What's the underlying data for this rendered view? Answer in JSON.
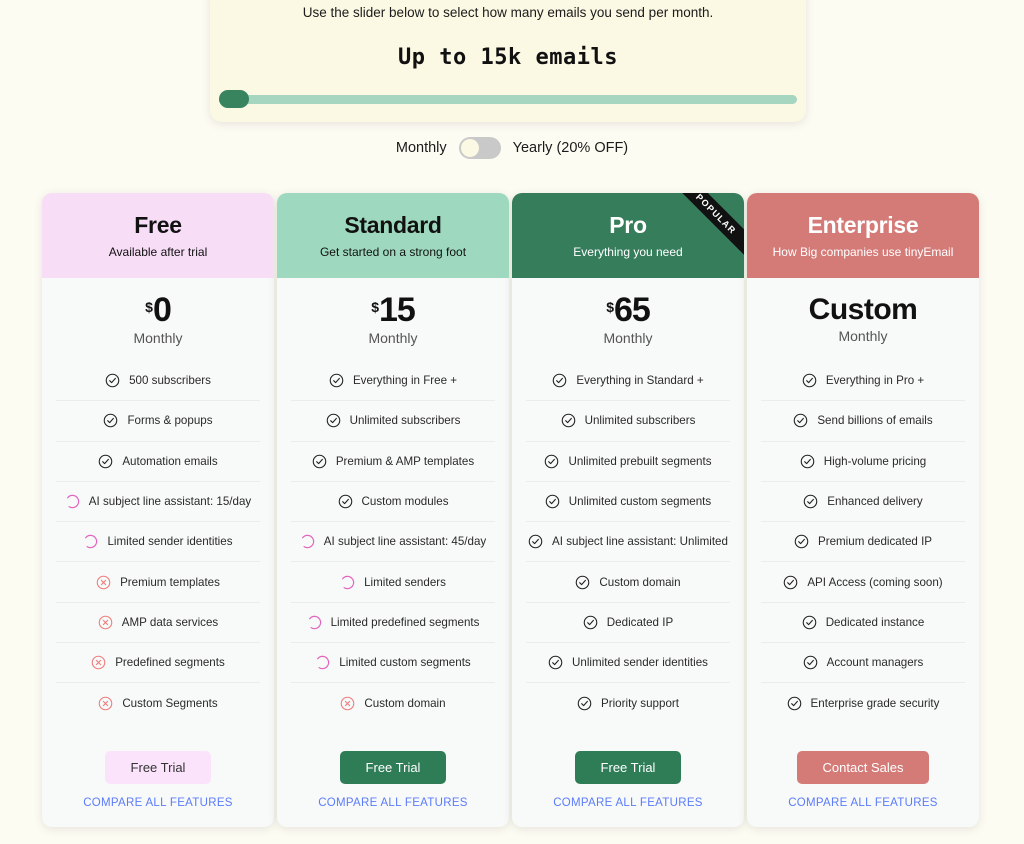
{
  "slider": {
    "caption": "Use the slider below to select how many emails you send per month.",
    "value_label": "Up to 15k emails",
    "fill_percent": 0,
    "track_color": "#a6d6bf",
    "handle_color": "#38845f",
    "panel_color": "#fbf8e3"
  },
  "billing": {
    "monthly_label": "Monthly",
    "yearly_label": "Yearly (20% OFF)",
    "selected": "Monthly"
  },
  "compare_link_label": "COMPARE ALL FEATURES",
  "plans": [
    {
      "name": "Free",
      "tagline": "Available after trial",
      "header_bg": "#f8ddf7",
      "header_fg": "#111111",
      "currency": "$",
      "amount": "0",
      "period": "Monthly",
      "ribbon": null,
      "cta_label": "Free Trial",
      "cta_bg": "#fbe4fb",
      "cta_fg": "#333333",
      "features": [
        {
          "icon": "check-icon",
          "label": "500 subscribers"
        },
        {
          "icon": "check-icon",
          "label": "Forms & popups"
        },
        {
          "icon": "check-icon",
          "label": "Automation emails"
        },
        {
          "icon": "partial-icon",
          "label": "AI subject line assistant: 15/day"
        },
        {
          "icon": "partial-icon",
          "label": "Limited sender identities"
        },
        {
          "icon": "cross-icon",
          "label": "Premium templates"
        },
        {
          "icon": "cross-icon",
          "label": "AMP data services"
        },
        {
          "icon": "cross-icon",
          "label": "Predefined segments"
        },
        {
          "icon": "cross-icon",
          "label": "Custom Segments"
        }
      ]
    },
    {
      "name": "Standard",
      "tagline": "Get started on a strong foot",
      "header_bg": "#9ed9bf",
      "header_fg": "#111111",
      "currency": "$",
      "amount": "15",
      "period": "Monthly",
      "ribbon": null,
      "cta_label": "Free Trial",
      "cta_bg": "#2f7d57",
      "cta_fg": "#ffffff",
      "features": [
        {
          "icon": "check-icon",
          "label": "Everything in Free +"
        },
        {
          "icon": "check-icon",
          "label": "Unlimited subscribers"
        },
        {
          "icon": "check-icon",
          "label": "Premium & AMP templates"
        },
        {
          "icon": "check-icon",
          "label": "Custom modules"
        },
        {
          "icon": "partial-icon",
          "label": "AI subject line assistant: 45/day"
        },
        {
          "icon": "partial-icon",
          "label": "Limited senders"
        },
        {
          "icon": "partial-icon",
          "label": "Limited predefined segments"
        },
        {
          "icon": "partial-icon",
          "label": "Limited custom segments"
        },
        {
          "icon": "cross-icon",
          "label": "Custom domain"
        }
      ]
    },
    {
      "name": "Pro",
      "tagline": "Everything you need",
      "header_bg": "#357d5b",
      "header_fg": "#ffffff",
      "currency": "$",
      "amount": "65",
      "period": "Monthly",
      "ribbon": "POPULAR",
      "cta_label": "Free Trial",
      "cta_bg": "#2f7d57",
      "cta_fg": "#ffffff",
      "features": [
        {
          "icon": "check-icon",
          "label": "Everything in Standard +"
        },
        {
          "icon": "check-icon",
          "label": "Unlimited subscribers"
        },
        {
          "icon": "check-icon",
          "label": "Unlimited prebuilt segments"
        },
        {
          "icon": "check-icon",
          "label": "Unlimited custom segments"
        },
        {
          "icon": "check-icon",
          "label": "AI subject line assistant: Unlimited"
        },
        {
          "icon": "check-icon",
          "label": "Custom domain"
        },
        {
          "icon": "check-icon",
          "label": "Dedicated IP"
        },
        {
          "icon": "check-icon",
          "label": "Unlimited sender identities"
        },
        {
          "icon": "check-icon",
          "label": "Priority support"
        }
      ]
    },
    {
      "name": "Enterprise",
      "tagline": "How Big companies use tinyEmail",
      "header_bg": "#d47b78",
      "header_fg": "#ffffff",
      "currency": "",
      "amount": "Custom",
      "period": "Monthly",
      "ribbon": null,
      "cta_label": "Contact Sales",
      "cta_bg": "#d47b78",
      "cta_fg": "#ffffff",
      "features": [
        {
          "icon": "check-icon",
          "label": "Everything in Pro +"
        },
        {
          "icon": "check-icon",
          "label": "Send billions of emails"
        },
        {
          "icon": "check-icon",
          "label": "High-volume pricing"
        },
        {
          "icon": "check-icon",
          "label": "Enhanced delivery"
        },
        {
          "icon": "check-icon",
          "label": "Premium dedicated IP"
        },
        {
          "icon": "check-icon",
          "label": "API Access (coming soon)"
        },
        {
          "icon": "check-icon",
          "label": "Dedicated instance"
        },
        {
          "icon": "check-icon",
          "label": "Account managers"
        },
        {
          "icon": "check-icon",
          "label": "Enterprise grade security"
        }
      ]
    }
  ]
}
